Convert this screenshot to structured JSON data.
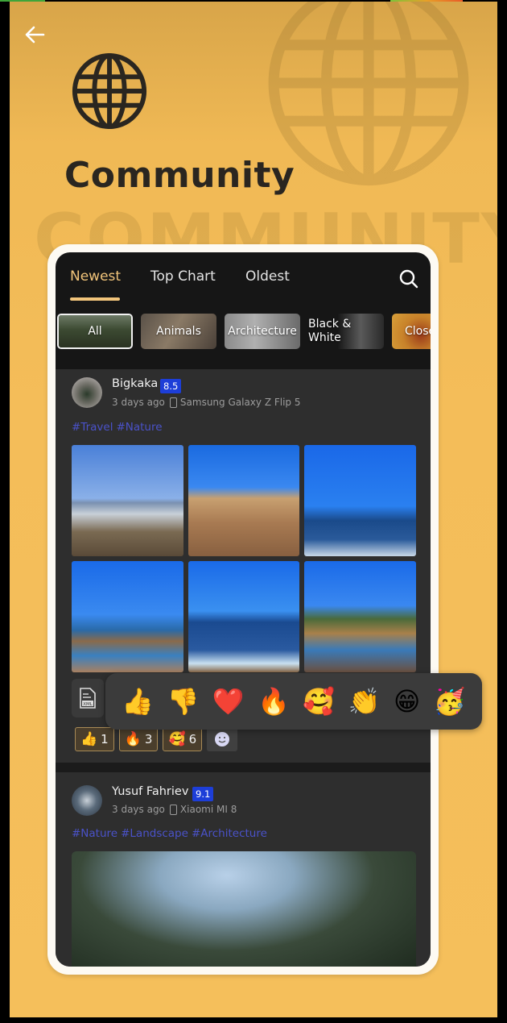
{
  "header": {
    "back_icon": "arrow-left-icon",
    "globe_icon": "globe-icon",
    "title": "Community",
    "background_word": "COMMUNITY"
  },
  "app": {
    "tabs": [
      {
        "label": "Newest",
        "active": true
      },
      {
        "label": "Top Chart",
        "active": false
      },
      {
        "label": "Oldest",
        "active": false
      }
    ],
    "search_icon": "search-icon",
    "categories": [
      {
        "label": "All",
        "active": true
      },
      {
        "label": "Animals",
        "active": false
      },
      {
        "label": "Architecture",
        "active": false
      },
      {
        "label": "Black & White",
        "active": false
      },
      {
        "label": "Close",
        "active": false
      }
    ],
    "posts": [
      {
        "username": "Bigkaka",
        "score": "8.5",
        "time": "3 days ago",
        "device": "Samsung Galaxy Z Flip 5",
        "tags": [
          "#Travel",
          "#Nature"
        ],
        "photo_count": 6,
        "attachment_label": "XML",
        "reactions": [
          {
            "emoji": "👍",
            "count": "1"
          },
          {
            "emoji": "🔥",
            "count": "3"
          },
          {
            "emoji": "🥰",
            "count": "6"
          }
        ],
        "add_reaction_icon": "smiley-icon"
      },
      {
        "username": "Yusuf Fahriev",
        "score": "9.1",
        "time": "3 days ago",
        "device": "Xiaomi MI 8",
        "tags": [
          "#Nature",
          "#Landscape",
          "#Architecture"
        ]
      }
    ],
    "reaction_picker": [
      "👍",
      "👎",
      "❤️",
      "🔥",
      "🥰",
      "👏",
      "😁",
      "🥳"
    ]
  },
  "colors": {
    "background": "#f5bf5b",
    "accent": "#f2c57b",
    "score_badge": "#1d3ed8",
    "tag": "#4a52c9",
    "card": "#2e2e2e"
  }
}
